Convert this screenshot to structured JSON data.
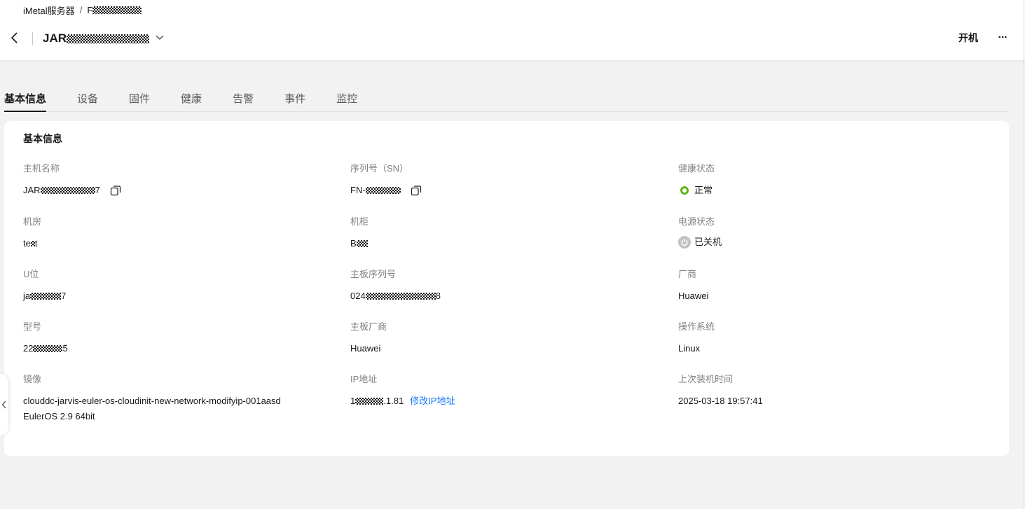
{
  "breadcrumb": {
    "parent": "iMetal服务器",
    "separator": "/",
    "current_prefix": "F"
  },
  "header": {
    "title_prefix": "JAR",
    "power_on_label": "开机",
    "more_label": "···"
  },
  "tabs": [
    {
      "label": "基本信息",
      "active": true
    },
    {
      "label": "设备"
    },
    {
      "label": "固件"
    },
    {
      "label": "健康"
    },
    {
      "label": "告警"
    },
    {
      "label": "事件"
    },
    {
      "label": "监控"
    }
  ],
  "basic_info": {
    "title": "基本信息",
    "host_name": {
      "label": "主机名称",
      "prefix": "JAR",
      "suffix": "7"
    },
    "serial_number": {
      "label": "序列号（SN）",
      "prefix": "FN-"
    },
    "health_status": {
      "label": "健康状态",
      "value": "正常",
      "color": "#5fb31c"
    },
    "room": {
      "label": "机房",
      "prefix": "te",
      "suffix": "t"
    },
    "cabinet": {
      "label": "机柜",
      "prefix": "B"
    },
    "power_status": {
      "label": "电源状态",
      "value": "已关机"
    },
    "u_position": {
      "label": "U位",
      "prefix": "ja",
      "suffix": "7"
    },
    "board_serial": {
      "label": "主板序列号",
      "prefix": "024",
      "suffix": "8"
    },
    "vendor": {
      "label": "厂商",
      "value": "Huawei"
    },
    "model": {
      "label": "型号",
      "prefix": "22",
      "suffix": "5"
    },
    "board_vendor": {
      "label": "主板厂商",
      "value": "Huawei"
    },
    "os": {
      "label": "操作系统",
      "value": "Linux"
    },
    "image": {
      "label": "镜像",
      "line1": "clouddc-jarvis-euler-os-cloudinit-new-network-modifyip-001aasd",
      "line2": "EulerOS 2.9 64bit"
    },
    "ip": {
      "label": "IP地址",
      "prefix": "1",
      "suffix": ".1.81",
      "modify_link": "修改IP地址"
    },
    "last_install": {
      "label": "上次装机时间",
      "value": "2025-03-18 19:57:41"
    }
  },
  "colors": {
    "link": "#1476ff",
    "healthy": "#5fb31c"
  }
}
